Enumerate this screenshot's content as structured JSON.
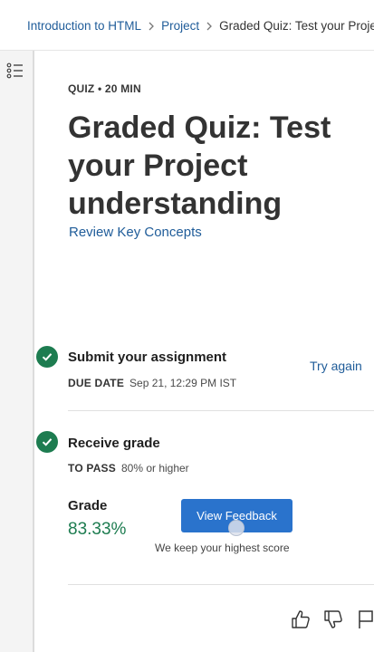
{
  "breadcrumb": {
    "items": [
      "Introduction to HTML",
      "Project"
    ],
    "current": "Graded Quiz: Test your Project unc"
  },
  "assignment": {
    "meta": "QUIZ • 20 MIN",
    "title": "Graded Quiz: Test your Project understanding",
    "review_link": "Review Key Concepts"
  },
  "submit": {
    "title": "Submit your assignment",
    "due_key": "DUE DATE",
    "due_value": "Sep 21, 12:29 PM IST",
    "try_again": "Try again"
  },
  "receive": {
    "title": "Receive grade",
    "pass_key": "TO PASS",
    "pass_value": "80% or higher"
  },
  "grade": {
    "label": "Grade",
    "value": "83.33%",
    "button": "View Feedback",
    "note": "We keep your highest score"
  },
  "colors": {
    "link": "#1f5c99",
    "success": "#1d7c50",
    "button": "#2a73cc"
  },
  "icons": [
    "table-of-contents-icon",
    "checkmark-icon",
    "chevron-right-icon",
    "thumbs-up-icon",
    "thumbs-down-icon",
    "flag-icon"
  ]
}
